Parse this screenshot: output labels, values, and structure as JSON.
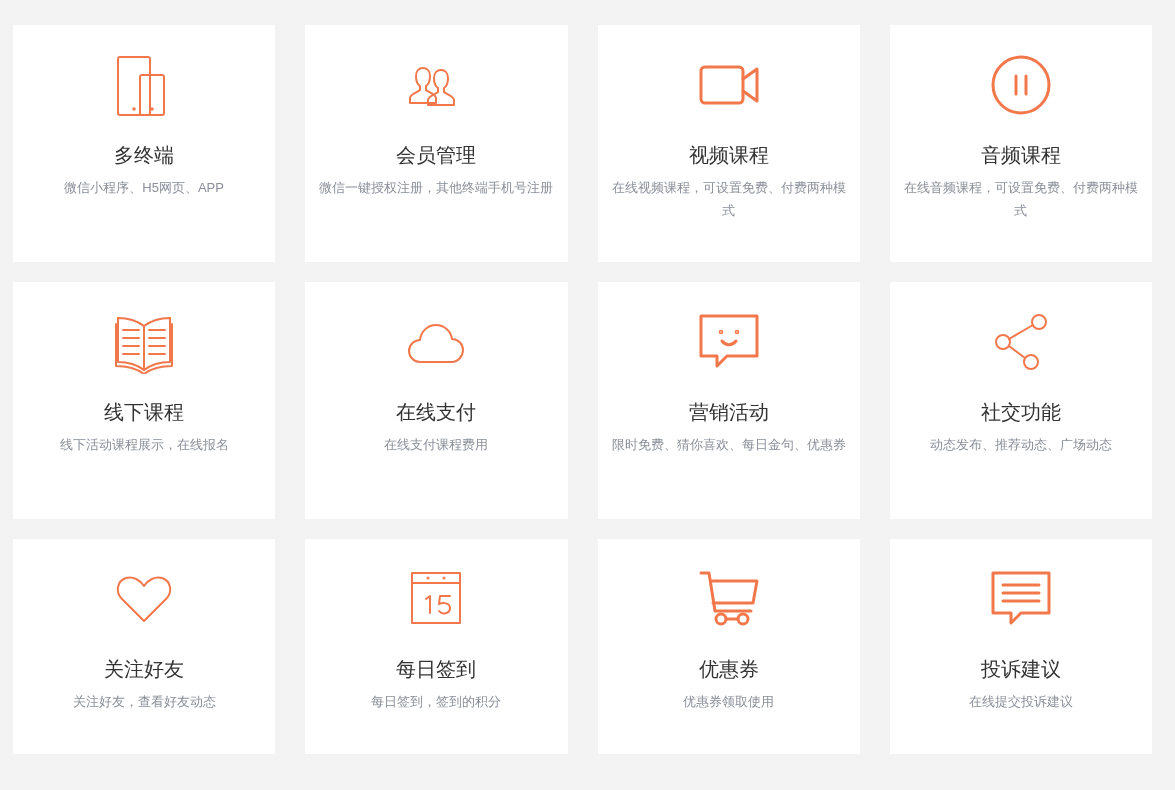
{
  "features": [
    {
      "title": "多终端",
      "description": "微信小程序、H5网页、APP"
    },
    {
      "title": "会员管理",
      "description": "微信一键授权注册，其他终端手机号注册"
    },
    {
      "title": "视频课程",
      "description": "在线视频课程，可设置免费、付费两种模式"
    },
    {
      "title": "音频课程",
      "description": "在线音频课程，可设置免费、付费两种模式"
    },
    {
      "title": "线下课程",
      "description": "线下活动课程展示，在线报名"
    },
    {
      "title": "在线支付",
      "description": "在线支付课程费用"
    },
    {
      "title": "营销活动",
      "description": "限时免费、猜你喜欢、每日金句、优惠券"
    },
    {
      "title": "社交功能",
      "description": "动态发布、推荐动态、广场动态"
    },
    {
      "title": "关注好友",
      "description": "关注好友，查看好友动态"
    },
    {
      "title": "每日签到",
      "description": "每日签到，签到的积分"
    },
    {
      "title": "优惠券",
      "description": "优惠券领取使用"
    },
    {
      "title": "投诉建议",
      "description": "在线提交投诉建议"
    }
  ]
}
